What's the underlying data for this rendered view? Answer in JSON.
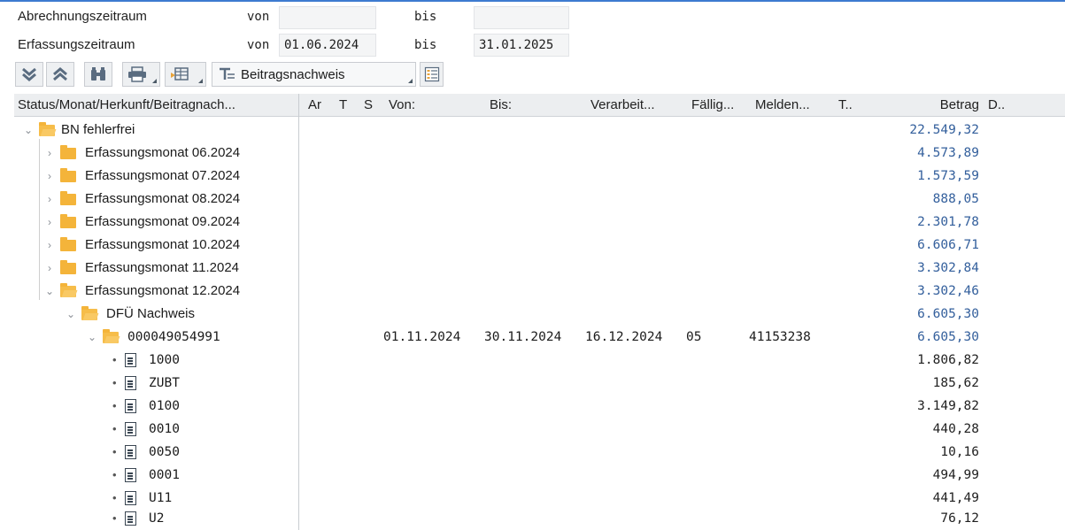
{
  "period": {
    "abrechnung_label": "Abrechnungszeitraum",
    "erfassung_label": "Erfassungszeitraum",
    "von_label": "von",
    "bis_label": "bis",
    "abrechnung_von": "",
    "abrechnung_bis": "",
    "erfassung_von": "01.06.2024",
    "erfassung_bis": "31.01.2025"
  },
  "toolbar": {
    "layout_label": "Beitragsnachweis"
  },
  "columns": {
    "tree": "Status/Monat/Herkunft/Beitragnach...",
    "ar": "Ar",
    "t": "T",
    "s": "S",
    "von": "Von:",
    "bis": "Bis:",
    "verarbeit": "Verarbeit...",
    "faellig": "Fällig...",
    "melden": "Melden...",
    "t2": "T..",
    "betrag": "Betrag",
    "d": "D.."
  },
  "rows": [
    {
      "label": "BN fehlerfrei",
      "betrag": "22.549,32"
    },
    {
      "label": "Erfassungsmonat  06.2024",
      "betrag": "4.573,89"
    },
    {
      "label": "Erfassungsmonat  07.2024",
      "betrag": "1.573,59"
    },
    {
      "label": "Erfassungsmonat  08.2024",
      "betrag": "888,05"
    },
    {
      "label": "Erfassungsmonat  09.2024",
      "betrag": "2.301,78"
    },
    {
      "label": "Erfassungsmonat  10.2024",
      "betrag": "6.606,71"
    },
    {
      "label": "Erfassungsmonat  11.2024",
      "betrag": "3.302,84"
    },
    {
      "label": "Erfassungsmonat  12.2024",
      "betrag": "3.302,46"
    },
    {
      "label": "DFÜ Nachweis",
      "betrag": "6.605,30"
    },
    {
      "label": "000049054991",
      "von": "01.11.2024",
      "bis": "30.11.2024",
      "verarbeit": "16.12.2024",
      "faellig": "05",
      "melden": "41153238",
      "betrag": "6.605,30"
    },
    {
      "label": "1000",
      "betrag": "1.806,82"
    },
    {
      "label": "ZUBT",
      "betrag": "185,62"
    },
    {
      "label": "0100",
      "betrag": "3.149,82"
    },
    {
      "label": "0010",
      "betrag": "440,28"
    },
    {
      "label": "0050",
      "betrag": "10,16"
    },
    {
      "label": "0001",
      "betrag": "494,99"
    },
    {
      "label": "U11",
      "betrag": "441,49"
    },
    {
      "label": "U2",
      "betrag": "76,12"
    }
  ]
}
